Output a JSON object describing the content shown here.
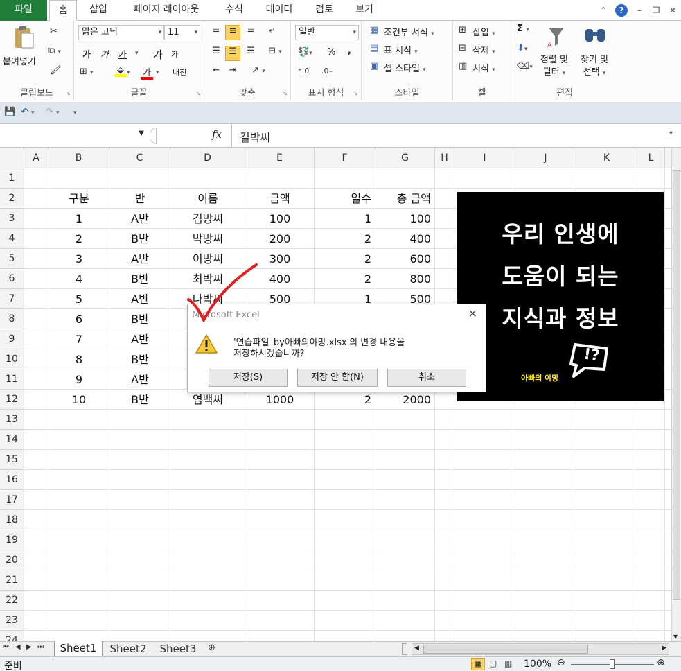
{
  "ribbon": {
    "tabs": [
      "파일",
      "홈",
      "삽입",
      "페이지 레이아웃",
      "수식",
      "데이터",
      "검토",
      "보기"
    ],
    "clipboard": {
      "paste": "붙여넣기",
      "label": "클립보드"
    },
    "font": {
      "name": "맑은 고딕",
      "size": "11",
      "label": "글꼴",
      "bold": "가",
      "italic": "가",
      "underline": "가",
      "grow": "가",
      "shrink": "가",
      "fill_color": "#ffff00",
      "font_color": "#ff0000",
      "color_glyph": "가",
      "phonetic": "내천"
    },
    "alignment": {
      "label": "맞춤"
    },
    "number": {
      "format": "일반",
      "percent": "%",
      "comma": ",",
      "label": "표시 형식"
    },
    "styles": {
      "conditional": "조건부 서식",
      "table": "표 서식",
      "cell": "셀 스타일",
      "label": "스타일"
    },
    "cells": {
      "insert": "삽입",
      "delete": "삭제",
      "format": "서식",
      "label": "셀"
    },
    "editing": {
      "sum": "Σ",
      "sort_line1": "정렬 및",
      "sort_line2": "필터",
      "find_line1": "찾기 및",
      "find_line2": "선택",
      "label": "편집"
    }
  },
  "formula_bar": {
    "fx": "fx",
    "content": "길박씨"
  },
  "columns": [
    "A",
    "B",
    "C",
    "D",
    "E",
    "F",
    "G",
    "H",
    "I",
    "J",
    "K",
    "L"
  ],
  "rows": [
    "1",
    "2",
    "3",
    "4",
    "5",
    "6",
    "7",
    "8",
    "9",
    "10",
    "11",
    "12",
    "13",
    "14",
    "15",
    "16",
    "17",
    "18",
    "19",
    "20",
    "21",
    "22",
    "23",
    "24"
  ],
  "table": {
    "headers": [
      "구분",
      "반",
      "이름",
      "금액",
      "일수",
      "총 금액"
    ],
    "rows": [
      [
        "1",
        "A반",
        "김방씨",
        "100",
        "1",
        "100"
      ],
      [
        "2",
        "B반",
        "박방씨",
        "200",
        "2",
        "400"
      ],
      [
        "3",
        "A반",
        "이방씨",
        "300",
        "2",
        "600"
      ],
      [
        "4",
        "B반",
        "최박씨",
        "400",
        "2",
        "800"
      ],
      [
        "5",
        "A반",
        "나박씨",
        "500",
        "1",
        "500"
      ],
      [
        "6",
        "B반",
        "",
        "",
        "",
        ""
      ],
      [
        "7",
        "A반",
        "",
        "",
        "",
        ""
      ],
      [
        "8",
        "B반",
        "",
        "",
        "",
        ""
      ],
      [
        "9",
        "A반",
        "",
        "",
        "",
        ""
      ],
      [
        "10",
        "B반",
        "염백씨",
        "1000",
        "2",
        "2000"
      ]
    ]
  },
  "promo": {
    "lines": [
      "우리 인생에",
      "도움이 되는",
      "지식과 정보"
    ],
    "brand": "아빠의 야망",
    "mark": "!?",
    "brand_color": "#ffe600"
  },
  "dialog": {
    "title": "Microsoft Excel",
    "message_line1": "'연습파일_by아빠의야망.xlsx'의 변경 내용을",
    "message_line2": "저장하시겠습니까?",
    "save": "저장(S)",
    "dont_save": "저장 안 함(N)",
    "cancel": "취소"
  },
  "sheets": [
    "Sheet1",
    "Sheet2",
    "Sheet3"
  ],
  "status": {
    "ready": "준비",
    "zoom": "100%"
  },
  "colors": {
    "excel_green": "#1f7f3a",
    "highlight": "#f8d35f",
    "check_mark": "#e02020"
  }
}
